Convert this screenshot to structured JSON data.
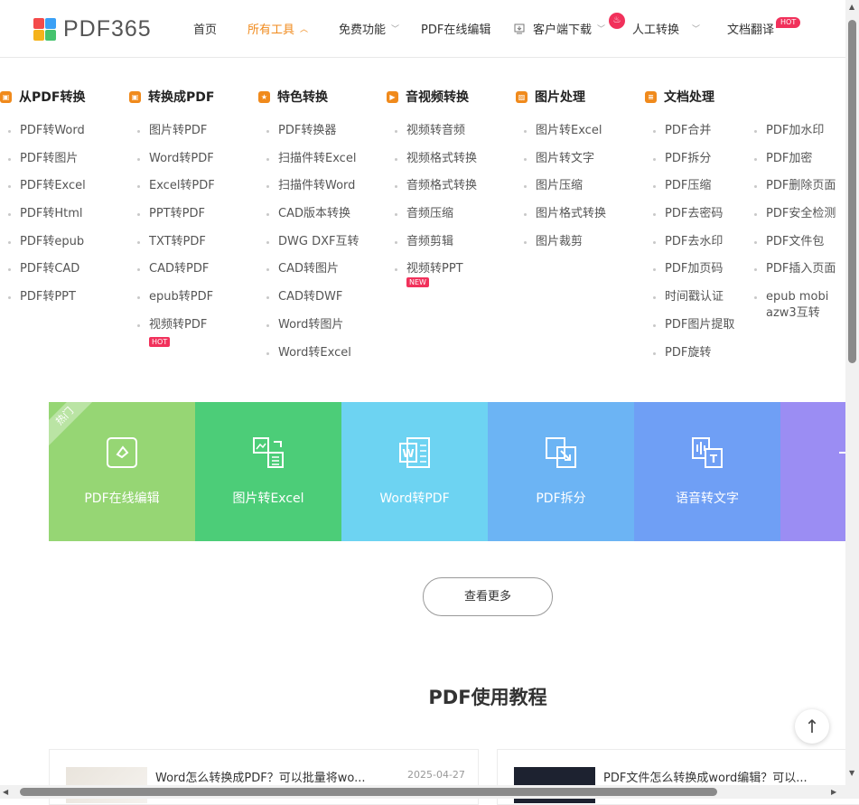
{
  "header": {
    "logo_text": "PDF365",
    "nav": [
      {
        "label": "首页"
      },
      {
        "label": "所有工具",
        "active": true
      },
      {
        "label": "免费功能"
      },
      {
        "label": "PDF在线编辑"
      },
      {
        "label": "客户端下载"
      },
      {
        "label": "人工转换"
      },
      {
        "label": "文档翻译"
      }
    ],
    "hot_badge": "HOT"
  },
  "menu": {
    "columns": [
      {
        "title": "从PDF转换",
        "items": [
          "PDF转Word",
          "PDF转图片",
          "PDF转Excel",
          "PDF转Html",
          "PDF转epub",
          "PDF转CAD",
          "PDF转PPT"
        ]
      },
      {
        "title": "转换成PDF",
        "items": [
          "图片转PDF",
          "Word转PDF",
          "Excel转PDF",
          "PPT转PDF",
          "TXT转PDF",
          "CAD转PDF",
          "epub转PDF",
          "视频转PDF"
        ],
        "hot_tag": "HOT"
      },
      {
        "title": "特色转换",
        "items": [
          "PDF转换器",
          "扫描件转Excel",
          "扫描件转Word",
          "CAD版本转换",
          "DWG DXF互转",
          "CAD转图片",
          "CAD转DWF",
          "Word转图片",
          "Word转Excel"
        ]
      },
      {
        "title": "音视频转换",
        "items": [
          "视频转音频",
          "视频格式转换",
          "音频格式转换",
          "音频压缩",
          "音频剪辑",
          "视频转PPT"
        ],
        "new_tag": "NEW"
      },
      {
        "title": "图片处理",
        "items": [
          "图片转Excel",
          "图片转文字",
          "图片压缩",
          "图片格式转换",
          "图片裁剪"
        ]
      },
      {
        "title": "文档处理",
        "items": [
          "PDF合并",
          "PDF拆分",
          "PDF压缩",
          "PDF去密码",
          "PDF去水印",
          "PDF加页码",
          "时间戳认证",
          "PDF图片提取",
          "PDF旋转"
        ]
      },
      {
        "title": "",
        "items": [
          "PDF加水印",
          "PDF加密",
          "PDF删除页面",
          "PDF安全检测",
          "PDF文件包",
          "PDF插入页面",
          "epub mobi azw3互转"
        ]
      }
    ]
  },
  "tiles": {
    "ribbon": "热门",
    "items": [
      {
        "label": "PDF在线编辑",
        "color": "#96d674",
        "icon": "edit-icon"
      },
      {
        "label": "图片转Excel",
        "color": "#4ccd78",
        "icon": "image-excel-icon"
      },
      {
        "label": "Word转PDF",
        "color": "#6dd3f2",
        "icon": "word-icon"
      },
      {
        "label": "PDF拆分",
        "color": "#6cb4f4",
        "icon": "split-icon"
      },
      {
        "label": "语音转文字",
        "color": "#6f9ff5",
        "icon": "voice-text-icon"
      },
      {
        "label": "PD",
        "color": "#9b8df3",
        "icon": "merge-icon"
      }
    ]
  },
  "more_button": "查看更多",
  "tutorials": {
    "title": "PDF使用教程",
    "cards": [
      {
        "title": "Word怎么转换成PDF？可以批量将wo...",
        "date": "2025-04-27"
      },
      {
        "title": "PDF文件怎么转换成word编辑？可以..."
      }
    ]
  },
  "back_to_top": "↑",
  "colors": {
    "accent": "#f08a1c",
    "hot": "#f1315b"
  }
}
